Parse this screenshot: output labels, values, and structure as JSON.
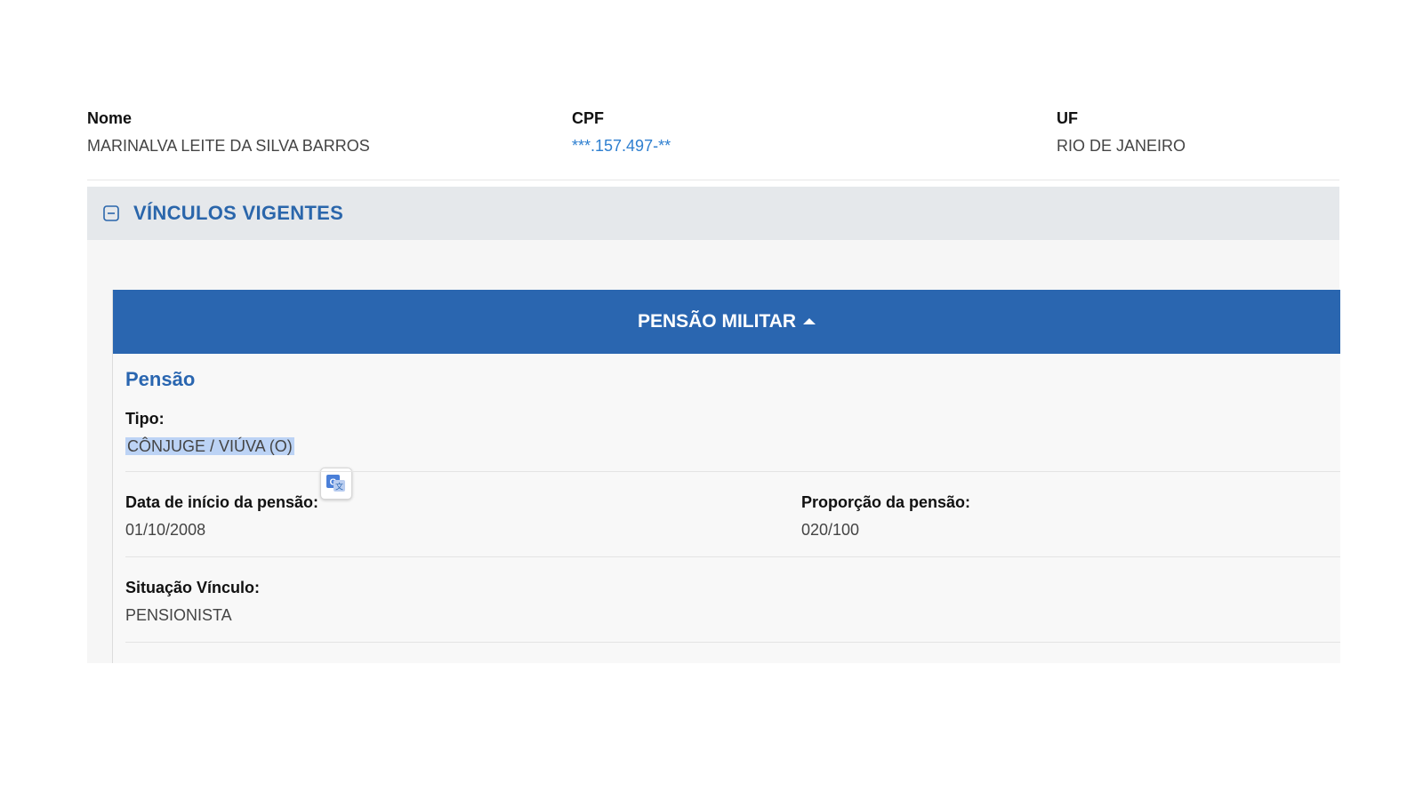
{
  "person": {
    "name_label": "Nome",
    "name_value": "MARINALVA LEITE DA SILVA BARROS",
    "cpf_label": "CPF",
    "cpf_value": "***.157.497-**",
    "uf_label": "UF",
    "uf_value": "RIO DE JANEIRO"
  },
  "section": {
    "title": "VÍNCULOS VIGENTES",
    "icon": "collapse-minus-icon"
  },
  "card": {
    "header": "PENSÃO MILITAR",
    "header_icon": "caret-up-icon",
    "subtitle": "Pensão",
    "tipo_label": "Tipo:",
    "tipo_value": "CÔNJUGE / VIÚVA (O)",
    "data_inicio_label": "Data de início da pensão:",
    "data_inicio_value": "01/10/2008",
    "proporcao_label": "Proporção da pensão:",
    "proporcao_value": "020/100",
    "situacao_label": "Situação Vínculo:",
    "situacao_value": "PENSIONISTA"
  },
  "colors": {
    "primary_blue": "#2a66b0",
    "link_blue": "#2e7fd0",
    "section_bg": "#e5e8eb",
    "selection_highlight": "#bcd3f5"
  },
  "overlay": {
    "translate_icon": "google-translate-icon"
  }
}
